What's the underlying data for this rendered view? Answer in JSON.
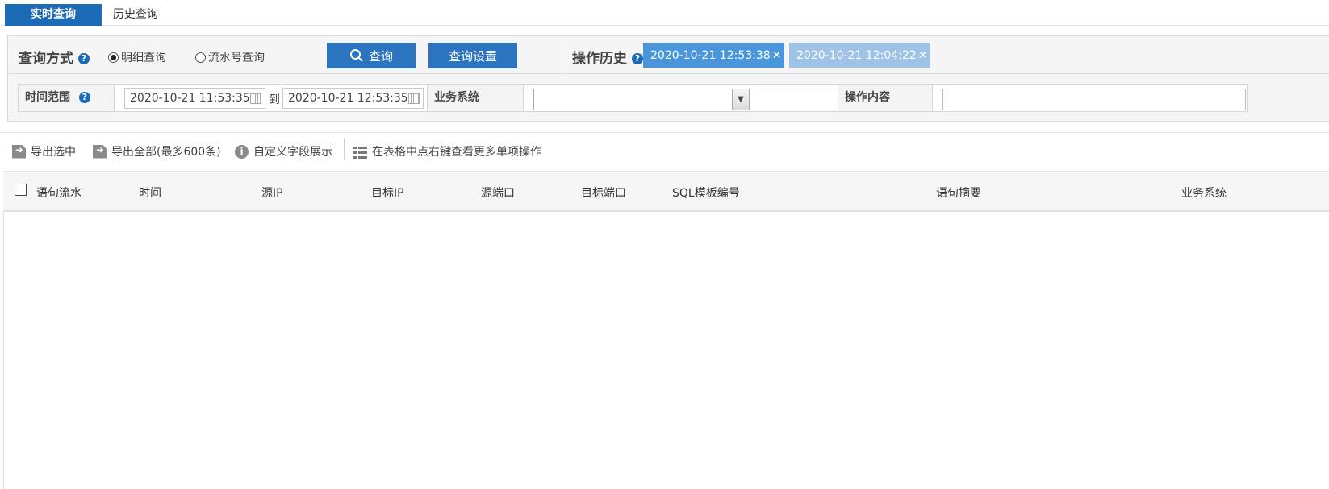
{
  "tabs": {
    "realtime": "实时查询",
    "history": "历史查询"
  },
  "query": {
    "method_label": "查询方式",
    "help": "?",
    "radio_detail": "明细查询",
    "radio_serial": "流水号查询",
    "selected": "明细查询",
    "search_button": "查询",
    "settings_button": "查询设置",
    "history_label": "操作历史",
    "history_items": [
      "2020-10-21 12:53:38",
      "2020-10-21 12:04:22"
    ],
    "close_symbol": "✕",
    "history_colors": [
      "#4b96db",
      "#9ec3e6"
    ]
  },
  "filters": {
    "time_range_label": "时间范围",
    "start": "2020-10-21 11:53:35",
    "to_text": "到",
    "end": "2020-10-21 12:53:35",
    "biz_system_label": "业务系统",
    "biz_system_value": "",
    "op_content_label": "操作内容",
    "op_content_value": ""
  },
  "toolbar": {
    "export_selected": "导出选中",
    "export_all": "导出全部(最多600条)",
    "custom_fields": "自定义字段展示",
    "hint": "在表格中点右键查看更多单项操作"
  },
  "table": {
    "columns": [
      "语句流水",
      "时间",
      "源IP",
      "目标IP",
      "源端口",
      "目标端口",
      "SQL模板编号",
      "语句摘要",
      "业务系统"
    ],
    "rows": []
  },
  "colors": {
    "primary": "#1c6bb7",
    "button": "#2b74c0"
  }
}
